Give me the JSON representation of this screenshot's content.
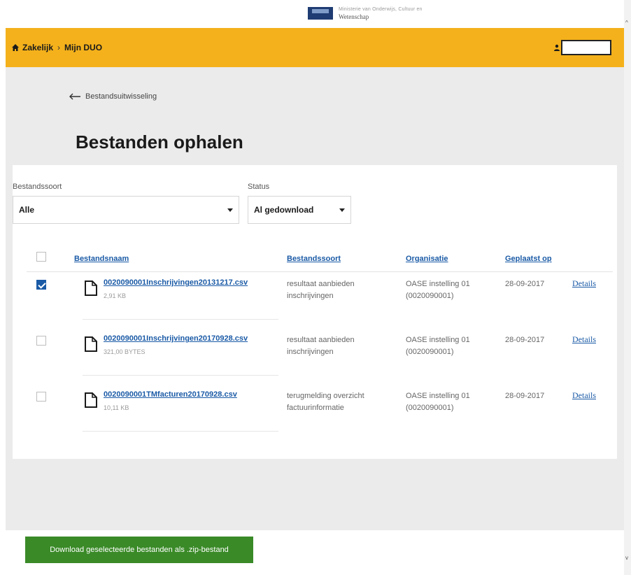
{
  "logo": {
    "line1": "Ministerie van Onderwijs, Cultuur en",
    "line2": "Wetenschap"
  },
  "header": {
    "breadcrumb": [
      "Zakelijk",
      "Mijn DUO"
    ],
    "user_name": ""
  },
  "main": {
    "back_link": "Bestandsuitwisseling",
    "title": "Bestanden ophalen"
  },
  "filters": {
    "type_label": "Bestandssoort",
    "type_value": "Alle",
    "status_label": "Status",
    "status_value": "Al gedownload"
  },
  "table": {
    "columns": [
      "Bestandsnaam",
      "Bestandssoort",
      "Organisatie",
      "Geplaatst op"
    ],
    "rows": [
      {
        "checked": true,
        "name": "0020090001Inschrijvingen20131217.csv",
        "size": "2,91 KB",
        "type_line1": "resultaat aanbieden",
        "type_line2": "inschrijvingen",
        "org_line1": "OASE instelling 01",
        "org_line2": "(0020090001)",
        "date": "28-09-2017",
        "details": "Details"
      },
      {
        "checked": false,
        "name": "0020090001Inschrijvingen20170928.csv",
        "size": "321,00 BYTES",
        "type_line1": "resultaat aanbieden",
        "type_line2": "inschrijvingen",
        "org_line1": "OASE instelling 01",
        "org_line2": "(0020090001)",
        "date": "28-09-2017",
        "details": "Details"
      },
      {
        "checked": false,
        "name": "0020090001TMfacturen20170928.csv",
        "size": "10,11 KB",
        "type_line1": "terugmelding overzicht",
        "type_line2": "factuurinformatie",
        "org_line1": "OASE instelling 01",
        "org_line2": "(0020090001)",
        "date": "28-09-2017",
        "details": "Details"
      }
    ]
  },
  "footer": {
    "zip_button": "Download geselecteerde bestanden als .zip-bestand"
  },
  "colors": {
    "header": "#f4b11b",
    "link": "#1a5aa6",
    "button": "#3a8a28",
    "page_bg": "#ebebeb"
  },
  "icons": [
    "home-icon",
    "user-icon",
    "arrow-left-icon",
    "file-icon",
    "checkbox",
    "caret-down-icon"
  ]
}
